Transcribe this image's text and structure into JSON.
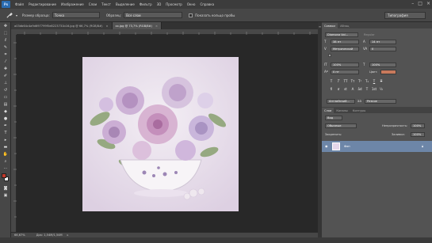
{
  "menubar": {
    "logo": "Ps",
    "items": [
      "Файл",
      "Редактирование",
      "Изображение",
      "Слои",
      "Текст",
      "Выделение",
      "Фильтр",
      "3D",
      "Просмотр",
      "Окно",
      "Справка"
    ],
    "controls": [
      "–",
      "□",
      "×"
    ]
  },
  "options": {
    "sample_size_label": "Размер образца:",
    "sample_size_value": "Точка",
    "sample_label": "Образец:",
    "sample_value": "Все слои",
    "ring_label": "Показать кольцо пробы",
    "workspace": "Типография"
  },
  "tabs": [
    {
      "title": "a03db64c4a9d697799f5e8223731b16.jpg @ 66,7% (RGB/8#)",
      "active": false
    },
    {
      "title": "xx.jpg @ 73,7% (RGB/8#)",
      "active": true
    }
  ],
  "status": {
    "zoom": "66,67%",
    "doc_size": "Док: 1,54M/1,54M"
  },
  "char_panel": {
    "tabs": [
      "Символ",
      "Абзац"
    ],
    "font_family": "Diamona Vol...",
    "font_style": "Regular",
    "font_size": "38 пт",
    "leading": "14 пт",
    "tracking": "Метрический",
    "kerning": "0",
    "vscale": "100%",
    "hscale": "100%",
    "baseline": "0 пт",
    "color_label": "Цвет:",
    "color_hex": "#c87a5c",
    "language": "Английский...",
    "antialias": "Резкое",
    "style_buttons": [
      "T",
      "T",
      "TT",
      "Tт",
      "T¹",
      "T₁",
      "T",
      "T"
    ],
    "ot_buttons": [
      "fi",
      "ơ",
      "st",
      "A",
      "ād",
      "T",
      "1st",
      "½"
    ]
  },
  "layers_panel": {
    "tabs": [
      "Слои",
      "Каналы",
      "Контуры"
    ],
    "filter_label": "Вид",
    "blend_mode": "Обычные",
    "opacity_label": "Непрозрачность:",
    "opacity_value": "100%",
    "lock_label": "Закрепить:",
    "fill_label": "Заливка:",
    "fill_value": "100%",
    "layer_name": "Фон"
  },
  "colors": {
    "accent_blue": "#6d86a8",
    "text_color_swatch": "#c87a5c",
    "fg_color": "#c0392b",
    "bg_color": "#f5f5f5"
  }
}
